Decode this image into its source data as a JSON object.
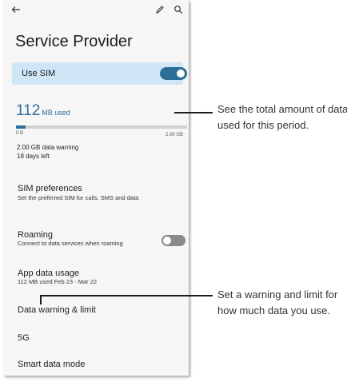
{
  "header": {
    "back_icon": "back-arrow-icon",
    "edit_icon": "pencil-icon",
    "search_icon": "search-icon"
  },
  "title": "Service Provider",
  "use_sim": {
    "label": "Use SIM",
    "enabled": true
  },
  "usage": {
    "amount": "112",
    "unit": "MB used",
    "bar_min": "0 B",
    "bar_max": "2.00 GB",
    "fraction": 0.055,
    "warning": "2.00 GB data warning",
    "days_left": "18 days left"
  },
  "sim_preferences": {
    "title": "SIM preferences",
    "subtitle": "Set the preferred SIM for calls, SMS and data"
  },
  "roaming": {
    "title": "Roaming",
    "subtitle": "Connect to data services when roaming",
    "enabled": false
  },
  "app_data_usage": {
    "title": "App data usage",
    "subtitle": "112 MB used Feb 23 - Mar 22"
  },
  "data_warning": {
    "title": "Data warning & limit"
  },
  "five_g": {
    "title": "5G"
  },
  "smart_data": {
    "title": "Smart data mode"
  },
  "callouts": {
    "usage": "See the total amount of data used for this period.",
    "warning": "Set a warning and limit for how much data you use."
  },
  "colors": {
    "accent": "#2d6f98",
    "sim_card_bg": "#cfe6f7",
    "toggle_off": "#8a8a8a"
  }
}
